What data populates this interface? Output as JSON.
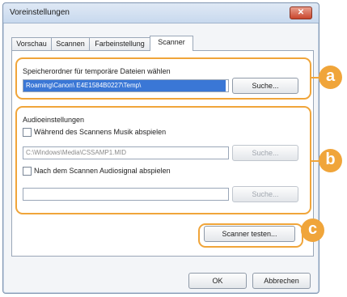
{
  "window": {
    "title": "Voreinstellungen",
    "close_label": "✕"
  },
  "tabs": [
    {
      "label": "Vorschau"
    },
    {
      "label": "Scannen"
    },
    {
      "label": "Farbeinstellung"
    },
    {
      "label": "Scanner"
    }
  ],
  "temp_folder": {
    "label": "Speicherordner für temporäre Dateien wählen",
    "path": "Roaming\\Canon\\            E4E1584B0227\\Temp\\",
    "browse_label": "Suche..."
  },
  "audio": {
    "group_label": "Audioeinstellungen",
    "music_checkbox_label": "Während des Scannens Musik abspielen",
    "music_path": "C:\\Windows\\Media\\CSSAMP1.MID",
    "music_browse_label": "Suche...",
    "signal_checkbox_label": "Nach dem Scannen Audiosignal abspielen",
    "signal_path": "",
    "signal_browse_label": "Suche..."
  },
  "test_button_label": "Scanner testen...",
  "footer": {
    "ok_label": "OK",
    "cancel_label": "Abbrechen"
  },
  "markers": [
    "a",
    "b",
    "c"
  ],
  "accent_color": "#f0a53a"
}
